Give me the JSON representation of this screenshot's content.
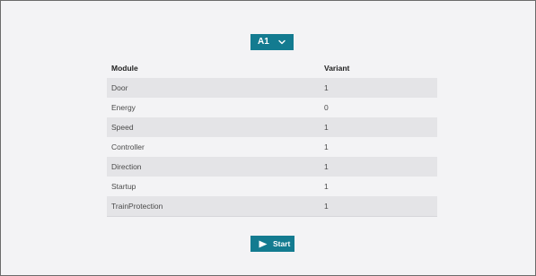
{
  "selector": {
    "value": "A1",
    "icon": "chevron-down-icon"
  },
  "table": {
    "headers": {
      "module": "Module",
      "variant": "Variant"
    },
    "rows": [
      {
        "module": "Door",
        "variant": "1"
      },
      {
        "module": "Energy",
        "variant": "0"
      },
      {
        "module": "Speed",
        "variant": "1"
      },
      {
        "module": "Controller",
        "variant": "1"
      },
      {
        "module": "Direction",
        "variant": "1"
      },
      {
        "module": "Startup",
        "variant": "1"
      },
      {
        "module": "TrainProtection",
        "variant": "1"
      }
    ]
  },
  "start_button": {
    "label": "Start",
    "icon": "play-icon"
  },
  "colors": {
    "accent": "#137b90",
    "background": "#f3f3f5",
    "row_stripe": "#e4e4e7"
  }
}
